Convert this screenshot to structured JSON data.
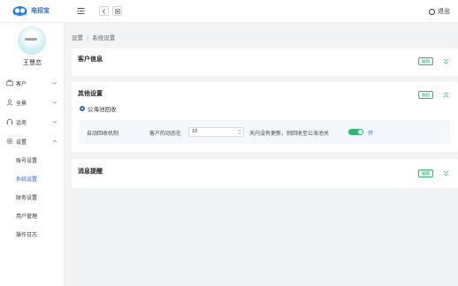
{
  "app": {
    "title": "电招宝",
    "logo_icon": "cloud-bird-logo-icon"
  },
  "header": {
    "logout_label": "退出"
  },
  "user": {
    "name": "王慧恋"
  },
  "sidebar": {
    "items": [
      {
        "label": "客户",
        "icon": "briefcase-icon"
      },
      {
        "label": "全景",
        "icon": "user-icon"
      },
      {
        "label": "话务",
        "icon": "headset-icon"
      },
      {
        "label": "设置",
        "icon": "gear-icon"
      }
    ],
    "settings_submenu": [
      {
        "label": "账号设置"
      },
      {
        "label": "系统设置",
        "active": true
      },
      {
        "label": "财务设置"
      },
      {
        "label": "用户管理"
      },
      {
        "label": "操作日志"
      }
    ]
  },
  "breadcrumb": {
    "root": "设置",
    "current": "系统设置"
  },
  "cards": {
    "customer_info": {
      "title": "客户信息",
      "button": "编辑"
    },
    "other_settings": {
      "title": "其他设置",
      "button": "收起",
      "section": "公海池回收",
      "rule": {
        "label": "自动回收机制",
        "prefix": "客户的动态在",
        "days_value": "10",
        "suffix": "天内没有更新，则回收至公海池关",
        "toggle_on": true,
        "toggle_text": "开"
      }
    },
    "message_reminder": {
      "title": "消息提醒",
      "button": "编辑"
    }
  },
  "colors": {
    "accent": "#2b67d6",
    "success": "#2eb872",
    "background": "#f2f3f5"
  }
}
